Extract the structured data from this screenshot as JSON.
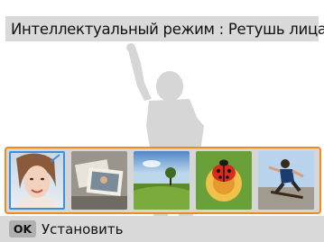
{
  "header": {
    "title": "Интеллектуальный режим : Ретушь лица"
  },
  "modes": [
    {
      "name": "face-retouch",
      "selected": true
    },
    {
      "name": "photo-collage",
      "selected": false
    },
    {
      "name": "landscape",
      "selected": false
    },
    {
      "name": "macro-ladybug",
      "selected": false
    },
    {
      "name": "action-skateboard",
      "selected": false
    }
  ],
  "footer": {
    "key_label": "OK",
    "action_label": "Установить"
  },
  "colors": {
    "accent": "#f08a1c",
    "selection": "#3d8edb",
    "bar": "#d9d9d9"
  }
}
